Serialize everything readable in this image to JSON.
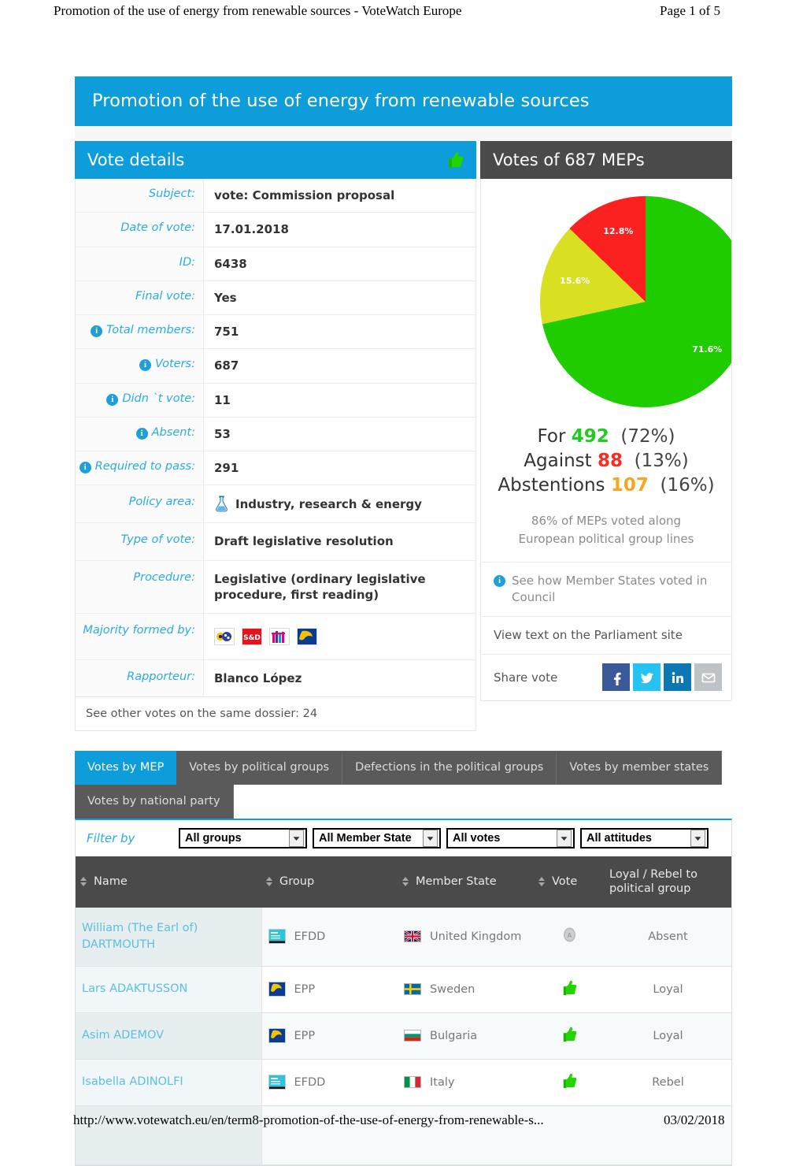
{
  "print": {
    "header_title": "Promotion of the use of energy from renewable sources - VoteWatch Europe",
    "header_page": "Page 1 of 5",
    "footer_url": "http://www.votewatch.eu/en/term8-promotion-of-the-use-of-energy-from-renewable-s...",
    "footer_date": "03/02/2018"
  },
  "page_title": "Promotion of the use of energy from renewable sources",
  "vote_details": {
    "panel_title": "Vote details",
    "rows": [
      {
        "label": "Subject:",
        "value": "vote: Commission proposal",
        "info": false
      },
      {
        "label": "Date of vote:",
        "value": "17.01.2018",
        "info": false
      },
      {
        "label": "ID:",
        "value": "6438",
        "info": false
      },
      {
        "label": "Final vote:",
        "value": "Yes",
        "info": false
      },
      {
        "label": "Total members:",
        "value": "751",
        "info": true
      },
      {
        "label": "Voters:",
        "value": "687",
        "info": true
      },
      {
        "label": "Didn `t vote:",
        "value": "11",
        "info": true
      },
      {
        "label": "Absent:",
        "value": "53",
        "info": true
      },
      {
        "label": "Required to pass:",
        "value": "291",
        "info": true
      },
      {
        "label": "Policy area:",
        "value": "Industry, research & energy",
        "info": false,
        "icon": "flask-icon"
      },
      {
        "label": "Type of vote:",
        "value": "Draft legislative resolution",
        "info": false
      },
      {
        "label": "Procedure:",
        "value": "Legislative (ordinary legislative procedure, first reading)",
        "info": false
      },
      {
        "label": "Majority formed by:",
        "value": "",
        "info": false,
        "icon": "party-logos"
      },
      {
        "label": "Rapporteur:",
        "value": "Blanco López",
        "info": false
      }
    ],
    "majority_logos": [
      "epp-logo",
      "sd-logo",
      "alde-logo",
      "ecr-logo"
    ],
    "dossier_note": "See other votes on the same dossier: 24"
  },
  "votes_panel": {
    "panel_title": "Votes of 687 MEPs",
    "for_label": "For",
    "for_value": "492",
    "for_pct": "(72%)",
    "against_label": "Against",
    "against_value": "88",
    "against_pct": "(13%)",
    "abstentions_label": "Abstentions",
    "abstentions_value": "107",
    "abstentions_pct": "(16%)",
    "along_lines": "86% of MEPs voted along European political group lines",
    "council_link": "See how Member States voted in Council",
    "parliament_link": "View text on the Parliament site",
    "share_label": "Share vote",
    "share_icons": [
      "facebook-icon",
      "twitter-icon",
      "linkedin-icon",
      "email-icon"
    ]
  },
  "chart_data": {
    "type": "pie",
    "title": "Votes of 687 MEPs",
    "categories": [
      "For",
      "Against",
      "Abstentions"
    ],
    "values": [
      492,
      88,
      107
    ],
    "percent_labels": [
      "71.6%",
      "12.8%",
      "15.6%"
    ],
    "colors": [
      "#1fcc00",
      "#fc2121",
      "#d9e021"
    ],
    "legend": "none",
    "start_angle_deg": 0,
    "direction": "clockwise",
    "slices": [
      {
        "name": "For",
        "value": 492,
        "pct": 71.6,
        "label": "71.6%",
        "color": "#1fcc00"
      },
      {
        "name": "Abstentions",
        "value": 107,
        "pct": 15.6,
        "label": "15.6%",
        "color": "#d9e021"
      },
      {
        "name": "Against",
        "value": 88,
        "pct": 12.8,
        "label": "12.8%",
        "color": "#fc2121"
      }
    ]
  },
  "tabs": [
    {
      "label": "Votes by MEP",
      "active": true
    },
    {
      "label": "Votes by political groups",
      "active": false
    },
    {
      "label": "Defections in the political groups",
      "active": false
    },
    {
      "label": "Votes by member states",
      "active": false
    },
    {
      "label": "Votes by national party",
      "active": false
    }
  ],
  "filters": {
    "label": "Filter by",
    "selects": [
      {
        "name": "groups-filter",
        "value": "All groups"
      },
      {
        "name": "member-state-filter",
        "value": "All Member State"
      },
      {
        "name": "votes-filter",
        "value": "All votes"
      },
      {
        "name": "attitudes-filter",
        "value": "All attitudes"
      }
    ]
  },
  "meps_table": {
    "columns": [
      "Name",
      "Group",
      "Member State",
      "Vote",
      "Loyal / Rebel to political group"
    ],
    "rows": [
      {
        "name": "William (The Earl of) DARTMOUTH",
        "group": "EFDD",
        "group_icon": "efdd-logo",
        "state": "United Kingdom",
        "flag": "uk-flag",
        "vote": "absent",
        "attitude": "Absent",
        "attitude_kind": "absent"
      },
      {
        "name": "Lars ADAKTUSSON",
        "group": "EPP",
        "group_icon": "epp-logo",
        "state": "Sweden",
        "flag": "sweden-flag",
        "vote": "for",
        "attitude": "Loyal",
        "attitude_kind": "loyal"
      },
      {
        "name": "Asim ADEMOV",
        "group": "EPP",
        "group_icon": "epp-logo",
        "state": "Bulgaria",
        "flag": "bulgaria-flag",
        "vote": "for",
        "attitude": "Loyal",
        "attitude_kind": "loyal"
      },
      {
        "name": "Isabella ADINOLFI",
        "group": "EFDD",
        "group_icon": "efdd-logo",
        "state": "Italy",
        "flag": "italy-flag",
        "vote": "for",
        "attitude": "Rebel",
        "attitude_kind": "rebel"
      }
    ]
  },
  "colors": {
    "brand_blue": "#0d9ddb",
    "dark_panel": "#4a4a4a",
    "label_blue": "#29abe2",
    "green": "#1fcc00",
    "red": "#fc2121",
    "yellow": "#d9e021"
  }
}
